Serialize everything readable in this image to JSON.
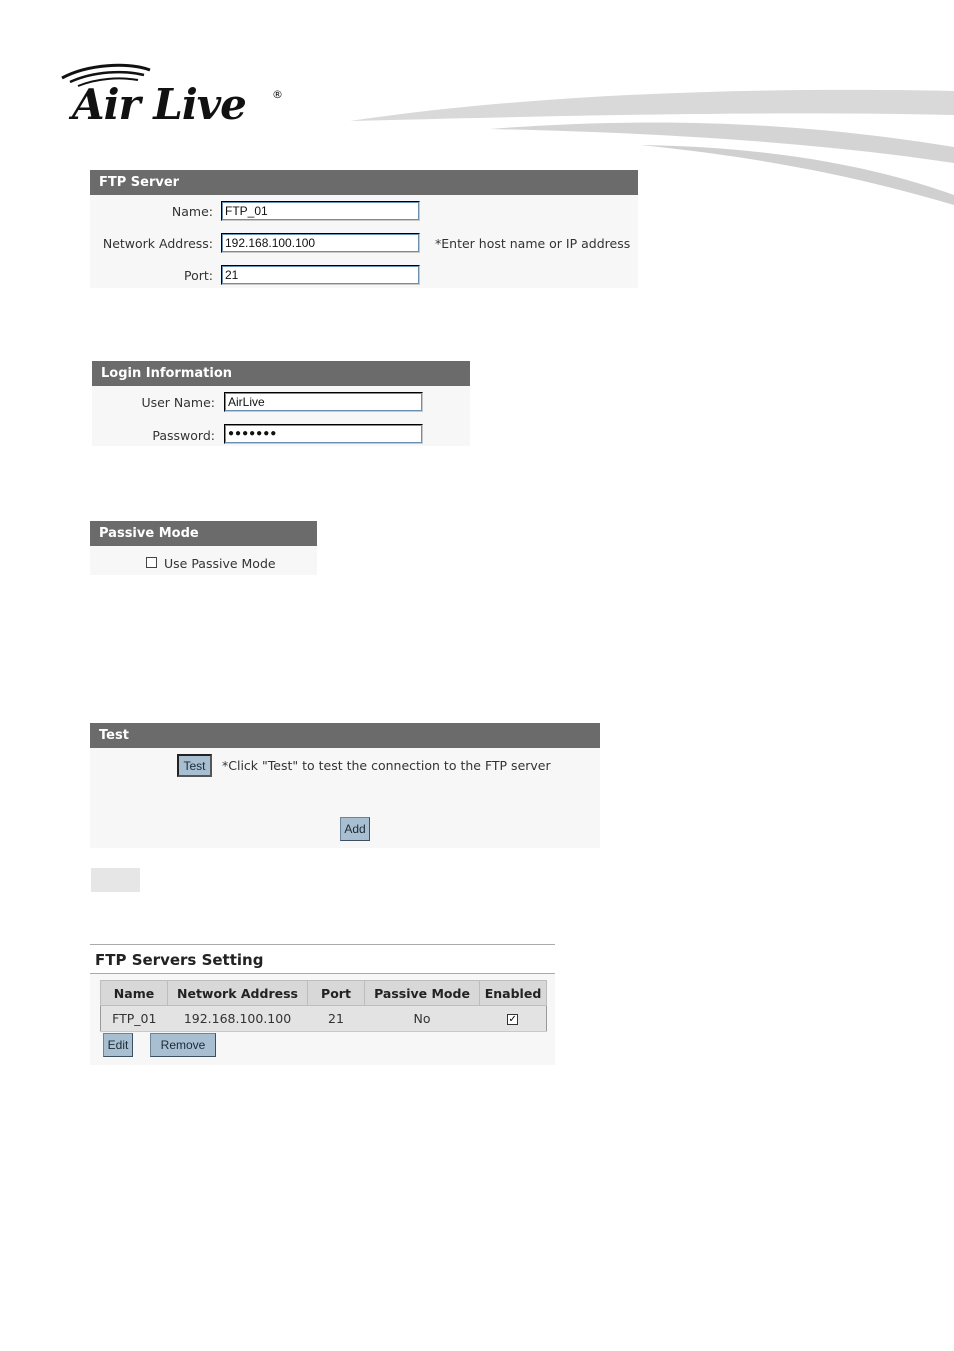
{
  "brand": {
    "logo_text": "Air Live",
    "reg_mark": "®"
  },
  "ftp_server": {
    "title": "FTP Server",
    "name_label": "Name:",
    "name_value": "FTP_01",
    "address_label": "Network Address:",
    "address_value": "192.168.100.100",
    "address_hint": "*Enter host name or IP address",
    "port_label": "Port:",
    "port_value": "21"
  },
  "login": {
    "title": "Login Information",
    "user_label": "User Name:",
    "user_value": "AirLive",
    "password_label": "Password:",
    "password_value": "●●●●●●●"
  },
  "passive": {
    "title": "Passive Mode",
    "checkbox_label": "Use Passive Mode",
    "checked": false
  },
  "test": {
    "title": "Test",
    "test_button": "Test",
    "hint": "*Click \"Test\" to test the connection to the FTP server",
    "add_button": "Add"
  },
  "servers_table": {
    "title": "FTP Servers Setting",
    "columns": [
      "Name",
      "Network Address",
      "Port",
      "Passive Mode",
      "Enabled"
    ],
    "rows": [
      {
        "name": "FTP_01",
        "address": "192.168.100.100",
        "port": "21",
        "passive": "No",
        "enabled": "✓"
      }
    ],
    "edit_button": "Edit",
    "remove_button": "Remove"
  }
}
